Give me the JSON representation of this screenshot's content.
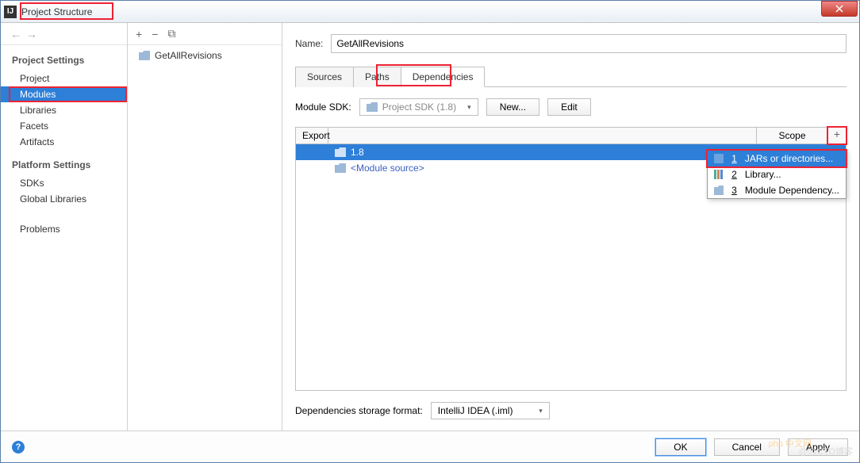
{
  "window": {
    "title": "Project Structure"
  },
  "sidebar": {
    "sections": [
      {
        "header": "Project Settings",
        "items": [
          "Project",
          "Modules",
          "Libraries",
          "Facets",
          "Artifacts"
        ]
      },
      {
        "header": "Platform Settings",
        "items": [
          "SDKs",
          "Global Libraries"
        ]
      }
    ],
    "problems": "Problems"
  },
  "modules": {
    "item": "GetAllRevisions"
  },
  "detail": {
    "name_label": "Name:",
    "name_value": "GetAllRevisions",
    "tabs": [
      "Sources",
      "Paths",
      "Dependencies"
    ],
    "sdk_label": "Module SDK:",
    "sdk_value": "Project SDK (1.8)",
    "btn_new": "New...",
    "btn_edit": "Edit",
    "table": {
      "col_export": "Export",
      "col_scope": "Scope",
      "rows": [
        {
          "label": "1.8",
          "selected": true
        },
        {
          "label": "<Module source>",
          "is_source": true
        }
      ]
    },
    "popup": [
      {
        "num": "1",
        "label": "JARs or directories...",
        "icon": "jars"
      },
      {
        "num": "2",
        "label": "Library...",
        "icon": "library"
      },
      {
        "num": "3",
        "label": "Module Dependency...",
        "icon": "module"
      }
    ],
    "storage_label": "Dependencies storage format:",
    "storage_value": "IntelliJ IDEA (.iml)"
  },
  "footer": {
    "ok": "OK",
    "cancel": "Cancel",
    "apply": "Apply"
  },
  "watermark": "@51CTO博客",
  "watermark2": "php 中文网"
}
